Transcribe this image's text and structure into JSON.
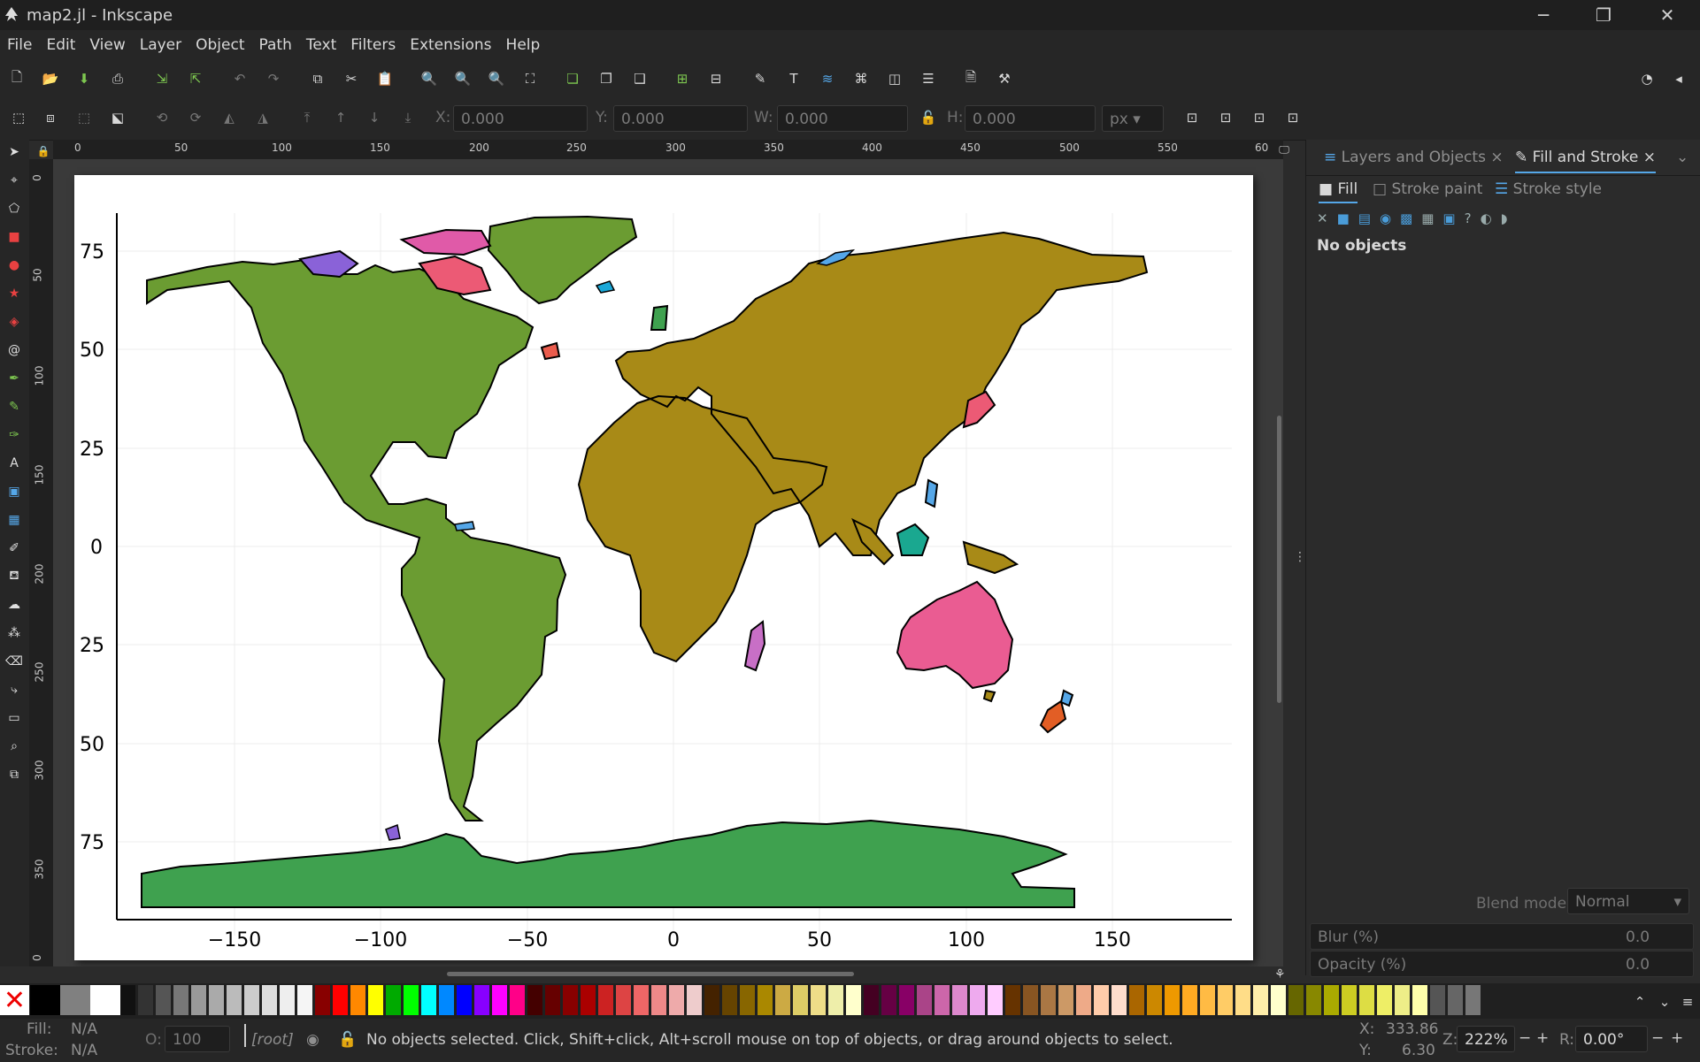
{
  "window": {
    "title": "map2.jl - Inkscape"
  },
  "menu": [
    "File",
    "Edit",
    "View",
    "Layer",
    "Object",
    "Path",
    "Text",
    "Filters",
    "Extensions",
    "Help"
  ],
  "controls": {
    "x_label": "X:",
    "x_value": "0.000",
    "y_label": "Y:",
    "y_value": "0.000",
    "w_label": "W:",
    "w_value": "0.000",
    "h_label": "H:",
    "h_value": "0.000",
    "unit": "px"
  },
  "rulers": {
    "horizontal": [
      "0",
      "50",
      "100",
      "150",
      "200",
      "250",
      "300",
      "350",
      "400",
      "450",
      "500",
      "550",
      "60"
    ],
    "vertical": [
      "0",
      "50",
      "100",
      "150",
      "200",
      "250",
      "300",
      "350",
      "0"
    ]
  },
  "map_plot": {
    "y_ticks": [
      "75",
      "50",
      "25",
      "0",
      "25",
      "50",
      "75"
    ],
    "x_ticks": [
      "−150",
      "−100",
      "−50",
      "0",
      "50",
      "100",
      "150"
    ],
    "colors": {
      "americas": "#6b9c32",
      "eurasia_africa": "#a88a17",
      "antarctica": "#3fa14f",
      "australia": "#ea5c92",
      "madagascar": "#c86fc6",
      "new_zealand": "#e25e25"
    }
  },
  "dock": {
    "tabs": [
      {
        "label": "Layers and Objects"
      },
      {
        "label": "Fill and Stroke"
      }
    ],
    "subtabs": [
      "Fill",
      "Stroke paint",
      "Stroke style"
    ],
    "message": "No objects",
    "blend_label": "Blend mode:",
    "blend_value": "Normal",
    "blur_label": "Blur (%)",
    "blur_value": "0.0",
    "opacity_label": "Opacity (%)",
    "opacity_value": "0.0"
  },
  "status": {
    "fill_label": "Fill:",
    "fill_value": "N/A",
    "stroke_label": "Stroke:",
    "stroke_value": "N/A",
    "o_label": "O:",
    "o_value": "100",
    "layer": "[root]",
    "message": "No objects selected. Click, Shift+click, Alt+scroll mouse on top of objects, or drag around objects to select.",
    "x_label": "X:",
    "x_value": "333.86",
    "y_label": "Y:",
    "y_value": "6.30",
    "zoom_label": "Z:",
    "zoom_value": "222%",
    "rot_label": "R:",
    "rot_value": "0.00°"
  }
}
